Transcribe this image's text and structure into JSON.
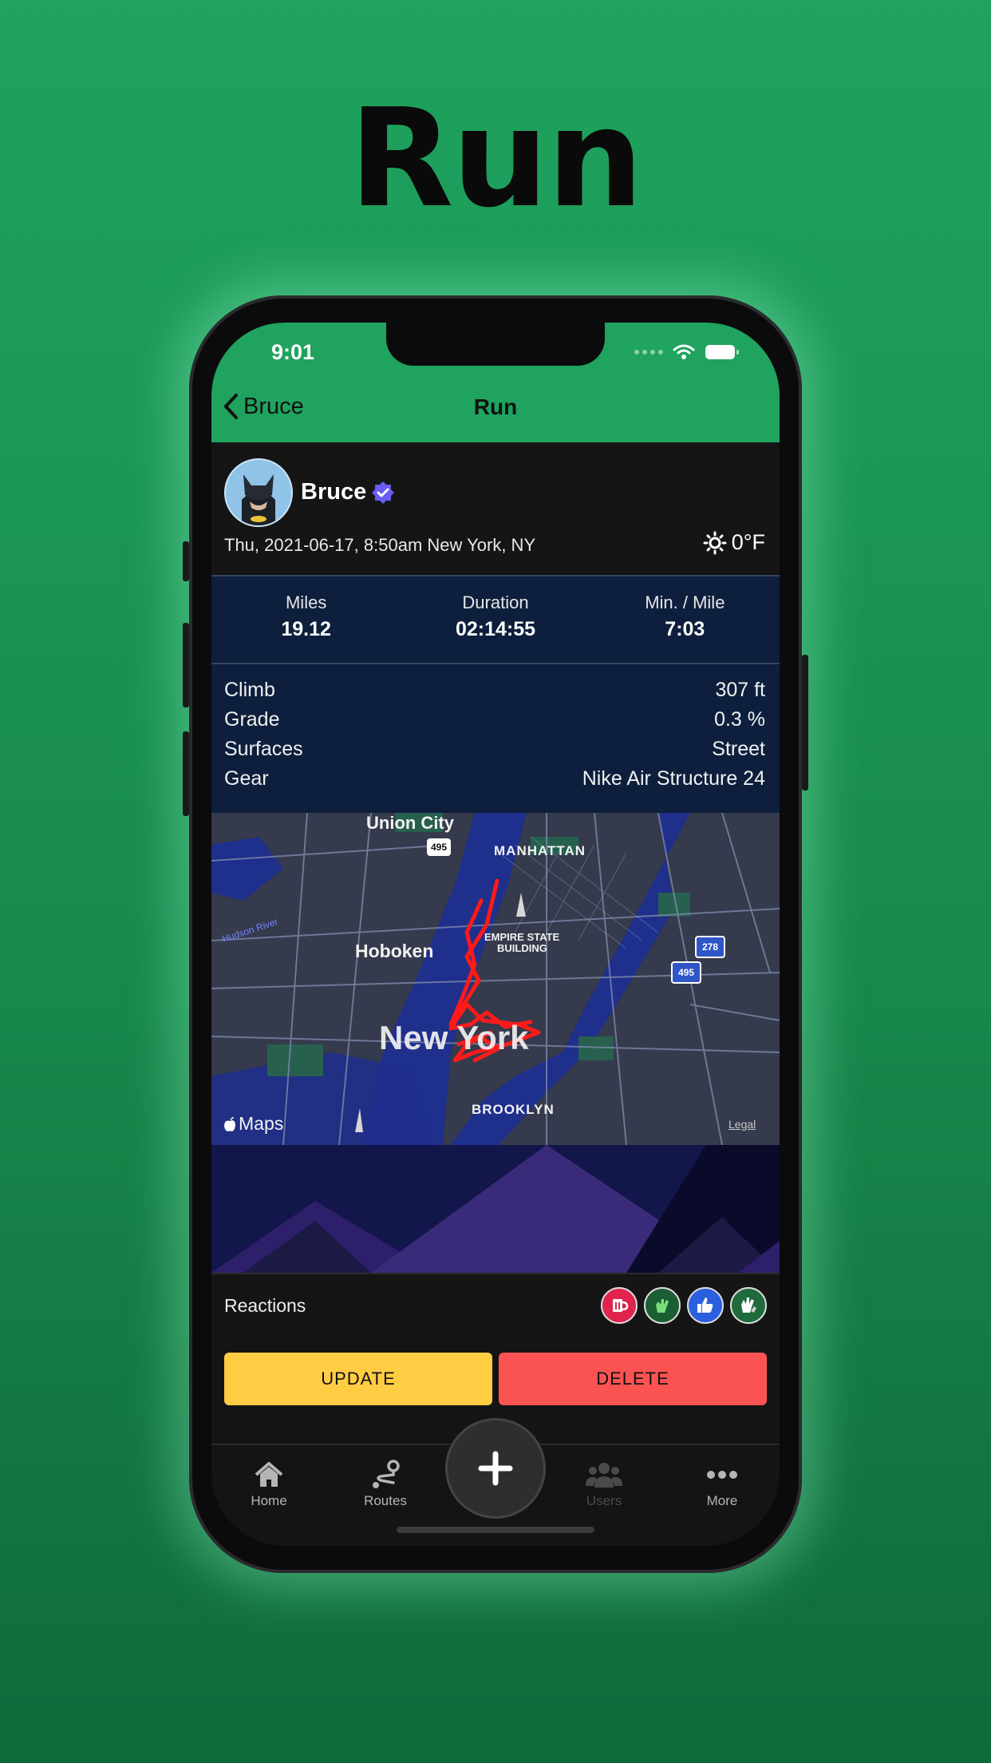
{
  "headline": "Run",
  "status_bar": {
    "time": "9:01"
  },
  "nav": {
    "back_label": "Bruce",
    "title": "Run"
  },
  "profile": {
    "name": "Bruce",
    "date_location": "Thu, 2021-06-17, 8:50am New York, NY",
    "weather_temp": "0°F",
    "weather_icon": "sun-icon"
  },
  "stats": [
    {
      "label": "Miles",
      "value": "19.12"
    },
    {
      "label": "Duration",
      "value": "02:14:55"
    },
    {
      "label": "Min. / Mile",
      "value": "7:03"
    }
  ],
  "details": [
    {
      "label": "Climb",
      "value": "307 ft"
    },
    {
      "label": "Grade",
      "value": "0.3 %"
    },
    {
      "label": "Surfaces",
      "value": "Street"
    },
    {
      "label": "Gear",
      "value": "Nike Air Structure 24"
    }
  ],
  "map": {
    "labels": {
      "union_city": "Union City",
      "manhattan": "MANHATTAN",
      "hoboken": "Hoboken",
      "empire": "EMPIRE STATE",
      "building": "BUILDING",
      "new_york": "New York",
      "brooklyn": "BROOKLYN",
      "hudson": "Hudson River",
      "maps_brand": "Maps",
      "legal": "Legal"
    },
    "shields": {
      "i495_left": "495",
      "i495_right": "495",
      "i278": "278"
    },
    "route_color": "#ff1a1a"
  },
  "reactions": {
    "label": "Reactions",
    "icons": [
      "beer-icon",
      "clap-hands-icon",
      "thumbs-up-icon",
      "high-five-icon"
    ]
  },
  "actions": {
    "update_label": "UPDATE",
    "delete_label": "DELETE"
  },
  "tabbar": {
    "items": [
      {
        "label": "Home",
        "icon": "home-icon"
      },
      {
        "label": "Routes",
        "icon": "routes-icon"
      },
      {
        "label": "Users",
        "icon": "users-icon"
      },
      {
        "label": "More",
        "icon": "more-icon"
      }
    ],
    "center_icon": "plus-icon"
  },
  "colors": {
    "background": "#1fa35f",
    "nav_bar": "#1fa35f",
    "stats_panel": "#0d1f3c",
    "update_button": "#ffcd44",
    "delete_button": "#fb5352"
  }
}
